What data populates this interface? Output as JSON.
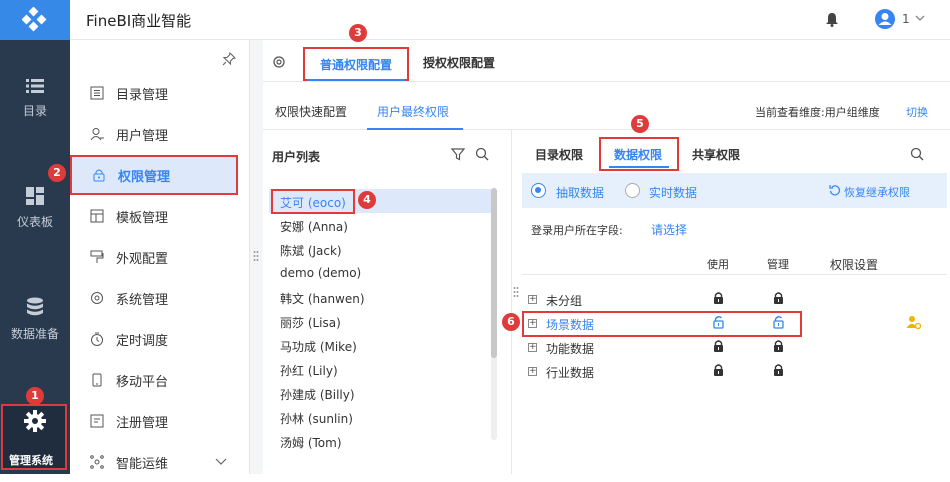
{
  "app": {
    "title": "FineBI商业智能",
    "user_num": "1"
  },
  "left_nav": [
    {
      "label": "目录",
      "icon": "list-icon"
    },
    {
      "label": "仪表板",
      "icon": "dashboard-icon"
    },
    {
      "label": "数据准备",
      "icon": "database-icon"
    },
    {
      "label": "管理系统",
      "icon": "gear-icon"
    }
  ],
  "menu": {
    "items": [
      {
        "label": "目录管理"
      },
      {
        "label": "用户管理"
      },
      {
        "label": "权限管理"
      },
      {
        "label": "模板管理"
      },
      {
        "label": "外观配置"
      },
      {
        "label": "系统管理"
      },
      {
        "label": "定时调度"
      },
      {
        "label": "移动平台"
      },
      {
        "label": "注册管理"
      },
      {
        "label": "智能运维"
      }
    ]
  },
  "tabs": {
    "general": "普通权限配置",
    "grant": "授权权限配置"
  },
  "subtabs": {
    "quick": "权限快速配置",
    "final": "用户最终权限",
    "dimension": "当前查看维度:用户组维度",
    "switch": "切换"
  },
  "user_list": {
    "title": "用户列表",
    "users": [
      "艾可 (eoco)",
      "安娜 (Anna)",
      "陈斌 (Jack)",
      "demo (demo)",
      "韩文 (hanwen)",
      "丽莎 (Lisa)",
      "马功成 (Mike)",
      "孙红 (Lily)",
      "孙建成 (Billy)",
      "孙林 (sunlin)",
      "汤姆 (Tom)"
    ]
  },
  "perm": {
    "tabs": [
      "目录权限",
      "数据权限",
      "共享权限"
    ],
    "mode_extract": "抽取数据",
    "mode_realtime": "实时数据",
    "restore": "恢复继承权限",
    "field_label": "登录用户所在字段:",
    "field_link": "请选择",
    "col_use": "使用",
    "col_manage": "管理",
    "col_setting": "权限设置",
    "rows": [
      "未分组",
      "场景数据",
      "功能数据",
      "行业数据"
    ]
  },
  "badges": [
    "1",
    "2",
    "3",
    "4",
    "5",
    "6"
  ],
  "colors": {
    "accent": "#3685f2",
    "nav_bg": "#2a3a4e",
    "red": "#e03b3b"
  }
}
